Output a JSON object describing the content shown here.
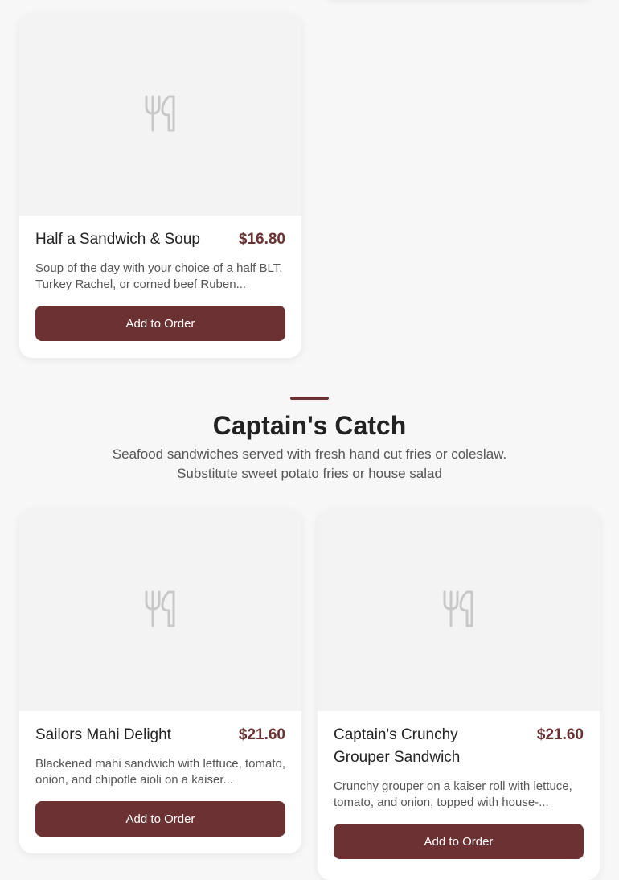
{
  "items": [
    {
      "name": "Half a Sandwich & Soup",
      "price": "$16.80",
      "description": "Soup of the day with your choice of a half BLT, Turkey Rachel, or corned beef Ruben...",
      "button": "Add to Order"
    },
    {
      "name": "Sailors Mahi Delight",
      "price": "$21.60",
      "description": "Blackened mahi sandwich with lettuce, tomato, onion, and chipotle aioli on a kaiser...",
      "button": "Add to Order"
    },
    {
      "name": "Captain's Crunchy Grouper Sandwich",
      "price": "$21.60",
      "description": "Crunchy grouper on a kaiser roll with lettuce, tomato, and onion, topped with house-...",
      "button": "Add to Order"
    }
  ],
  "section": {
    "title": "Captain's Catch",
    "subtitle_line1": "Seafood sandwiches served with fresh hand cut fries or coleslaw.",
    "subtitle_line2": "Substitute sweet potato fries or house salad"
  },
  "icons": {
    "placeholder": "utensils-icon"
  },
  "colors": {
    "accent": "#6b3133",
    "background": "#f7f7f7",
    "image_placeholder": "#f3f3f3"
  }
}
